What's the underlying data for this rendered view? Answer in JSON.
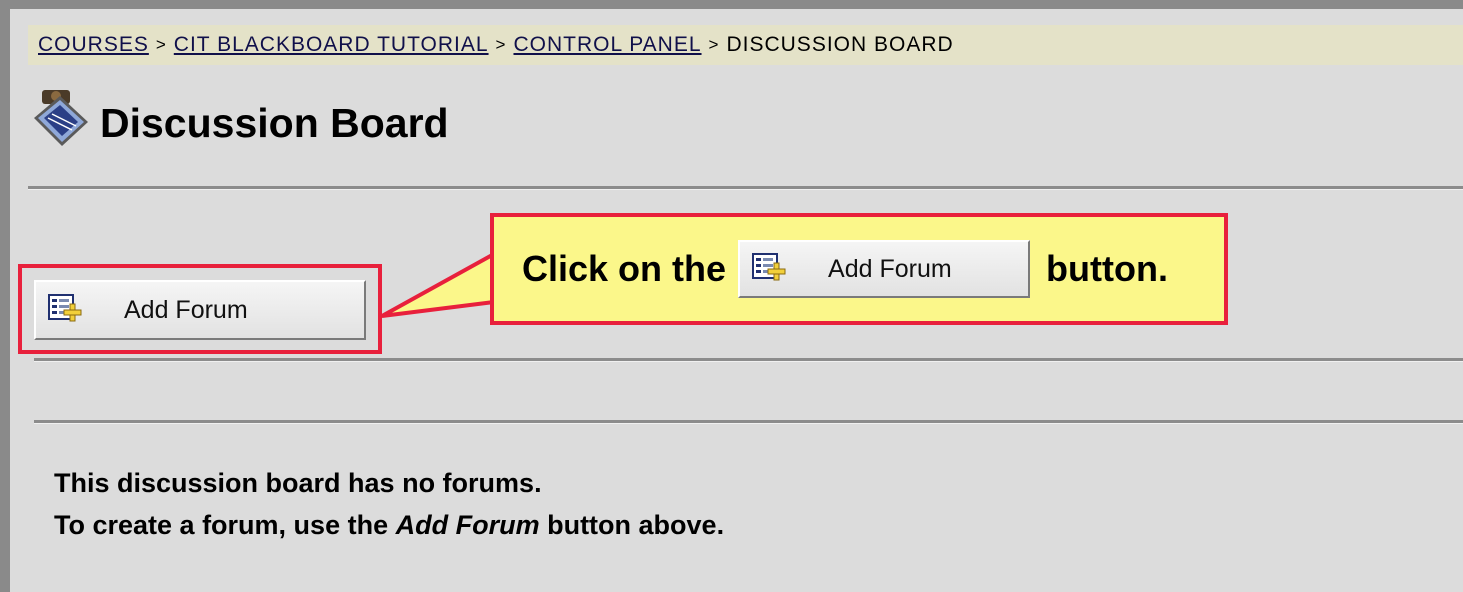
{
  "breadcrumb": {
    "items": [
      "COURSES",
      "CIT BLACKBOARD TUTORIAL",
      "CONTROL PANEL",
      "DISCUSSION BOARD"
    ],
    "separator": ">"
  },
  "page": {
    "title": "Discussion Board",
    "icon": "discussion-board-icon"
  },
  "toolbar": {
    "add_forum_label": "Add Forum",
    "add_forum_icon": "add-forum-icon"
  },
  "callout": {
    "prefix": "Click on the",
    "button_label": "Add Forum",
    "suffix": "button."
  },
  "message": {
    "line1": "This discussion board has no forums.",
    "line2_prefix": "To create a forum, use the ",
    "line2_emphasis": "Add Forum",
    "line2_suffix": " button above."
  },
  "colors": {
    "highlight": "#e8203c",
    "callout_bg": "#fbf78a",
    "breadcrumb_bg": "#e4e2c8",
    "page_bg": "#dcdcdc"
  }
}
